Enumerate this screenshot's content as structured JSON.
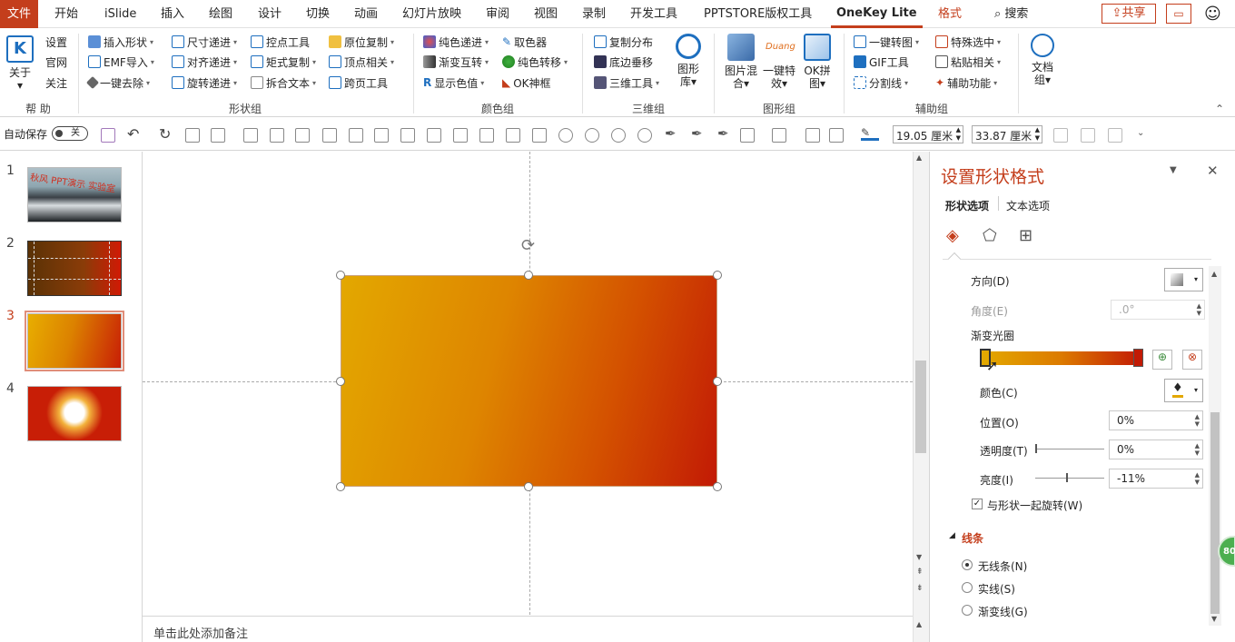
{
  "tabs": [
    "文件",
    "开始",
    "iSlide",
    "插入",
    "绘图",
    "设计",
    "切换",
    "动画",
    "幻灯片放映",
    "审阅",
    "视图",
    "录制",
    "开发工具",
    "PPTSTORE版权工具",
    "OneKey Lite",
    "格式",
    "搜索"
  ],
  "top_right": {
    "share": "共享"
  },
  "ribbon": {
    "about": "关于",
    "settings": "设置",
    "website": "官网",
    "follow": "关注",
    "help_group": "帮 助",
    "insert_shape": "插入形状",
    "emf_import": "EMF导入",
    "one_key_remove": "一键去除",
    "size_step": "尺寸递进",
    "align_step": "对齐递进",
    "rotate_step": "旋转递进",
    "ctrl_point": "控点工具",
    "matrix_copy": "矩式复制",
    "split_text": "拆合文本",
    "origin_copy": "原位复制",
    "vertex": "顶点相关",
    "cross_page": "跨页工具",
    "shape_group": "形状组",
    "pure_step": "纯色递进",
    "grad_swap": "渐变互转",
    "show_color": "显示色值",
    "picker": "取色器",
    "pure_convert": "纯色转移",
    "ok_frame": "OK神框",
    "color_group": "颜色组",
    "copy_dist": "复制分布",
    "bottom_hang": "底边垂移",
    "three_d_tools": "三维工具",
    "shape_lib_1": "图形",
    "shape_lib_2": "库",
    "three_d_group": "三维组",
    "pic_mix_1": "图片混",
    "pic_mix_2": "合",
    "one_key_fx_1": "一键特",
    "one_key_fx_2": "效",
    "ok_puzzle_1": "OK拼",
    "ok_puzzle_2": "图",
    "duang": "Duang",
    "graphic_group": "图形组",
    "one_key_to_pic": "一键转图",
    "gif_tool": "GIF工具",
    "split_line": "分割线",
    "special_select": "特殊选中",
    "paste_rel": "粘贴相关",
    "aux_func": "辅助功能",
    "doc_group_1": "文档",
    "doc_group_2": "组",
    "aux_group": "辅助组"
  },
  "qat": {
    "autosave": "自动保存",
    "autosave_state": "关",
    "height": "19.05 厘米",
    "width": "33.87 厘米"
  },
  "slides": [
    {
      "num": "1",
      "thumb_text": "秋风 PPT演示 实验室"
    },
    {
      "num": "2"
    },
    {
      "num": "3"
    },
    {
      "num": "4"
    }
  ],
  "active_slide": "3",
  "notes_placeholder": "单击此处添加备注",
  "pane": {
    "title": "设置形状格式",
    "tab_shape": "形状选项",
    "tab_text": "文本选项",
    "direction": "方向(D)",
    "angle": "角度(E)",
    "angle_value": ".0°",
    "gradient_stops": "渐变光圈",
    "color": "颜色(C)",
    "position": "位置(O)",
    "position_value": "0%",
    "transparency": "透明度(T)",
    "transparency_value": "0%",
    "brightness": "亮度(I)",
    "brightness_value": "-11%",
    "rotate_with_shape": "与形状一起旋转(W)",
    "line_section": "线条",
    "no_line": "无线条(N)",
    "solid_line": "实线(S)",
    "gradient_line": "渐变线(G)",
    "badge": "80"
  },
  "colors": {
    "accent": "#c43e1c",
    "grad_start": "#e3a800",
    "grad_end": "#c21a05"
  }
}
